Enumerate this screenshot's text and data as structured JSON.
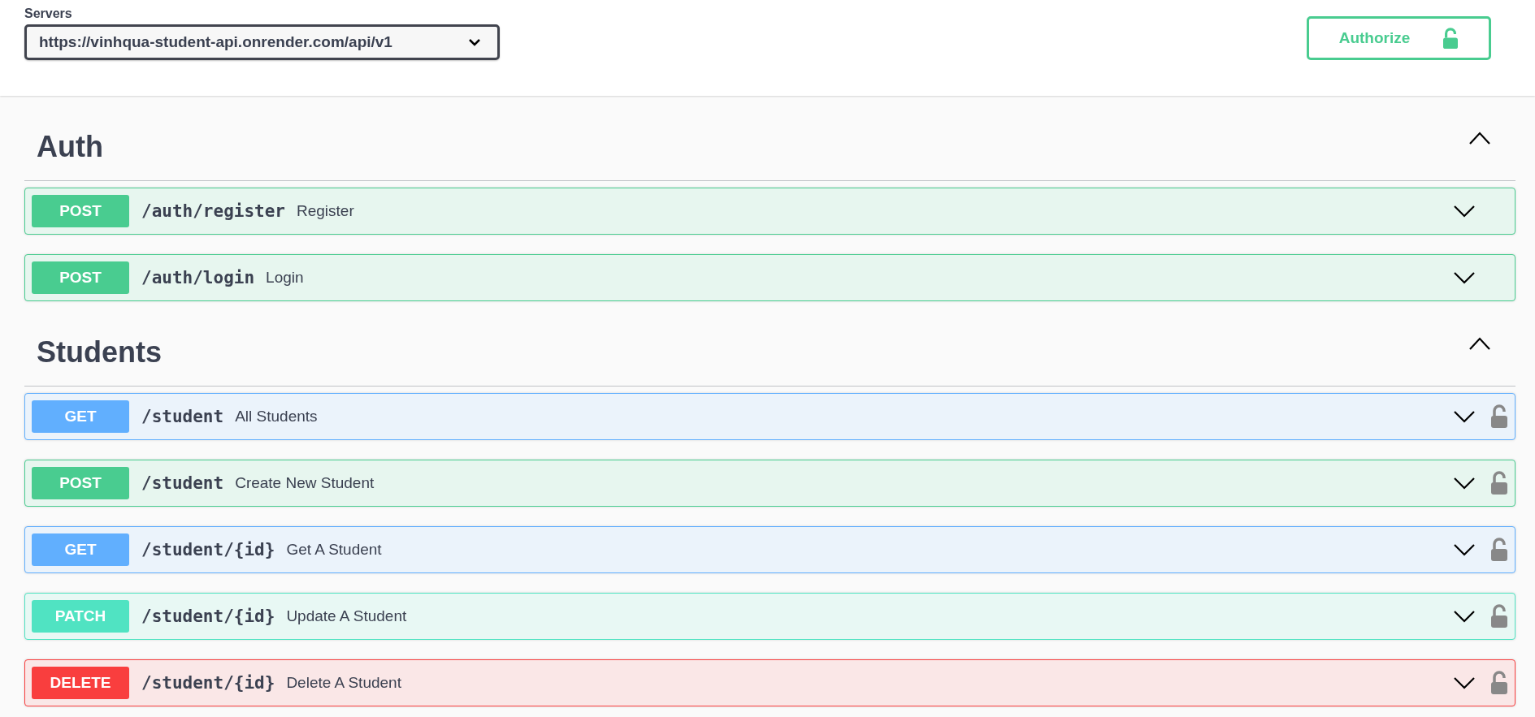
{
  "servers": {
    "label": "Servers",
    "value": "https://vinhqua-student-api.onrender.com/api/v1"
  },
  "authorize": {
    "label": "Authorize"
  },
  "sections": [
    {
      "name": "Auth",
      "expanded": true,
      "operations": [
        {
          "method": "POST",
          "path": "/auth/register",
          "summary": "Register",
          "expanded": false,
          "secured": false
        },
        {
          "method": "POST",
          "path": "/auth/login",
          "summary": "Login",
          "expanded": false,
          "secured": false
        }
      ]
    },
    {
      "name": "Students",
      "expanded": true,
      "operations": [
        {
          "method": "GET",
          "path": "/student",
          "summary": "All Students",
          "expanded": false,
          "secured": true
        },
        {
          "method": "POST",
          "path": "/student",
          "summary": "Create New Student",
          "expanded": false,
          "secured": true
        },
        {
          "method": "GET",
          "path": "/student/{id}",
          "summary": "Get A Student",
          "expanded": false,
          "secured": true
        },
        {
          "method": "PATCH",
          "path": "/student/{id}",
          "summary": "Update A Student",
          "expanded": false,
          "secured": true
        },
        {
          "method": "DELETE",
          "path": "/student/{id}",
          "summary": "Delete A Student",
          "expanded": false,
          "secured": true
        }
      ]
    }
  ]
}
